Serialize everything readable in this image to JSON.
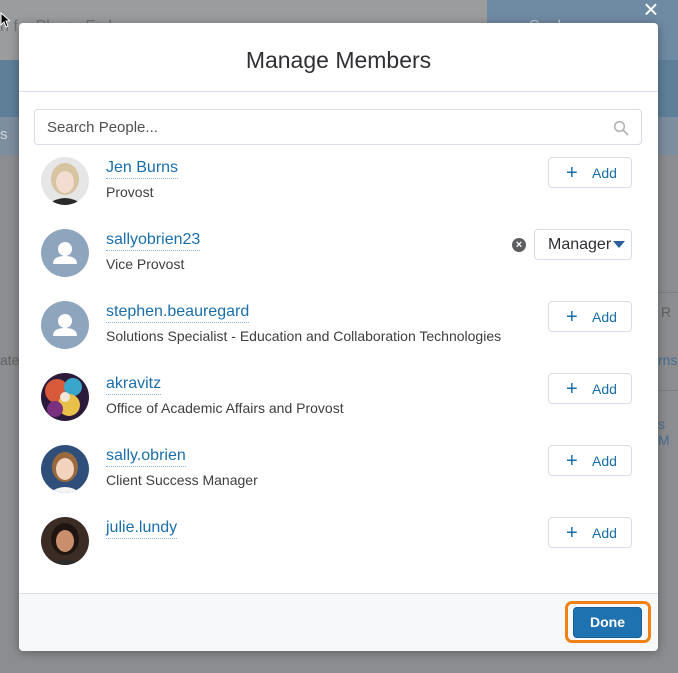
{
  "background": {
    "title_fragment": "n f... Pl... r.. Fr. l",
    "blue_button_fragment": "S... l",
    "tab_fragment": "s",
    "fragments": [
      "ate",
      "R",
      "rns",
      "s M"
    ]
  },
  "modal": {
    "title": "Manage Members",
    "close_glyph": "×",
    "search": {
      "placeholder": "Search People...",
      "value": ""
    },
    "members": [
      {
        "name": "Jen Burns",
        "title": "Provost",
        "action": "Add",
        "avatar": "photo-woman-blonde"
      },
      {
        "name": "sallyobrien23",
        "title": "Vice Provost",
        "role": "Manager",
        "avatar": "default-user"
      },
      {
        "name": "stephen.beauregard",
        "title": "Solutions Specialist - Education and Collaboration Technologies",
        "action": "Add",
        "avatar": "default-user"
      },
      {
        "name": "akravitz",
        "title": "Office of Academic Affairs and Provost",
        "action": "Add",
        "avatar": "photo-abstract-art"
      },
      {
        "name": "sally.obrien",
        "title": "Client Success Manager",
        "action": "Add",
        "avatar": "photo-woman-smiling"
      },
      {
        "name": "julie.lundy",
        "title": "",
        "action": "Add",
        "avatar": "photo-woman-dark-hair"
      }
    ],
    "add_plus": "+",
    "remove_glyph": "×",
    "footer": {
      "done_label": "Done"
    }
  },
  "colors": {
    "link": "#1a6fa9",
    "primary_button": "#1f72b0",
    "highlight_ring": "#f07f14"
  }
}
